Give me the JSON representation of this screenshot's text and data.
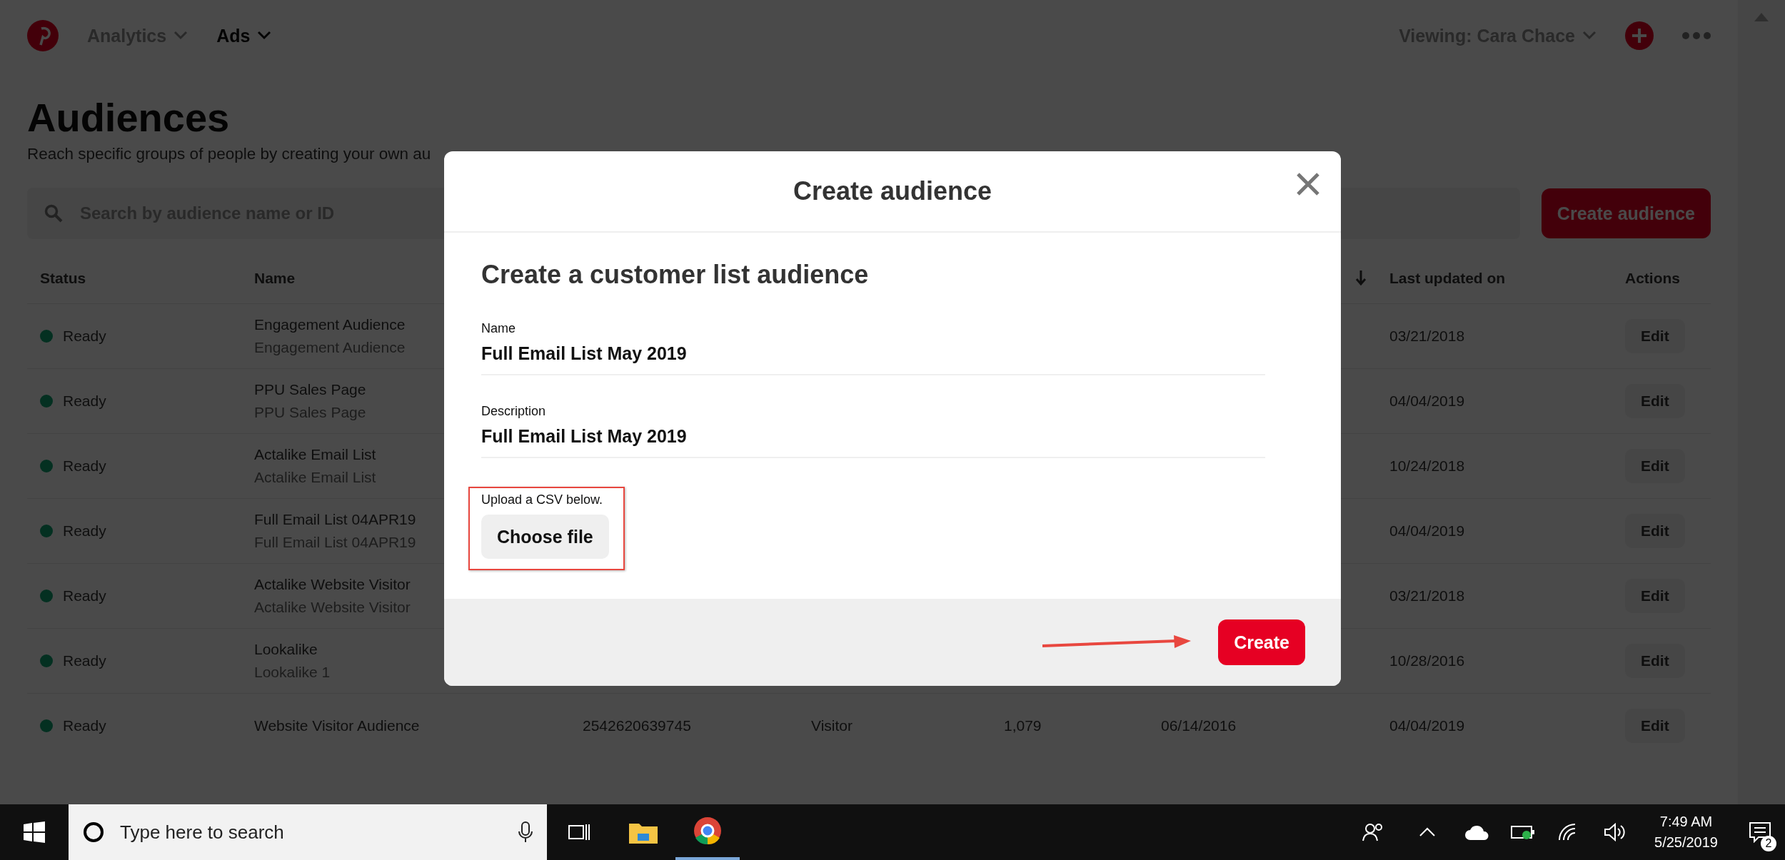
{
  "nav": {
    "items": [
      {
        "label": "Analytics",
        "selected": false
      },
      {
        "label": "Ads",
        "selected": true
      }
    ],
    "viewing": "Viewing: Cara Chace"
  },
  "page": {
    "title": "Audiences",
    "subtitle": "Reach specific groups of people by creating your own au",
    "search": {
      "placeholder": "Search by audience name or ID"
    },
    "create_button": "Create audience"
  },
  "table": {
    "header": {
      "status": "Status",
      "name": "Name",
      "last_updated": "Last updated on",
      "actions": "Actions"
    },
    "rows": [
      {
        "status": "Ready",
        "name": "Engagement Audience",
        "description": "Engagement Audience",
        "updated": "03/21/2018",
        "action": "Edit"
      },
      {
        "status": "Ready",
        "name": "PPU Sales Page",
        "description": "PPU Sales Page",
        "updated": "04/04/2019",
        "action": "Edit"
      },
      {
        "status": "Ready",
        "name": "Actalike Email List",
        "description": "Actalike Email List",
        "updated": "10/24/2018",
        "action": "Edit"
      },
      {
        "status": "Ready",
        "name": "Full Email List 04APR19",
        "description": "Full Email List 04APR19",
        "updated": "04/04/2019",
        "action": "Edit"
      },
      {
        "status": "Ready",
        "name": "Actalike Website Visitor",
        "description": "Actalike Website Visitor",
        "updated": "03/21/2018",
        "action": "Edit"
      },
      {
        "status": "Ready",
        "name": "Lookalike",
        "description": "Lookalike 1",
        "updated": "10/28/2016",
        "action": "Edit"
      },
      {
        "status": "Ready",
        "name": "Website Visitor Audience",
        "id": "2542620639745",
        "type": "Visitor",
        "size": "1,079",
        "created": "06/14/2016",
        "updated": "04/04/2019",
        "action": "Edit"
      }
    ]
  },
  "modal": {
    "title": "Create audience",
    "heading": "Create a customer list audience",
    "fields": [
      {
        "label": "Name",
        "value": "Full Email List May 2019"
      },
      {
        "label": "Description",
        "value": "Full Email List May 2019"
      }
    ],
    "upload_label": "Upload a CSV below.",
    "choose_button": "Choose file",
    "create_button": "Create"
  },
  "taskbar": {
    "search": {
      "placeholder": "Type here to search"
    },
    "time": "7:49 AM",
    "date": "5/25/2019",
    "notifications": "2"
  }
}
